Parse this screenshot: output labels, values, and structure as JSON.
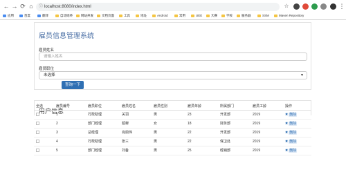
{
  "browser": {
    "url": "localhost:8080/index.html",
    "bookmarks": [
      "应用",
      "百度",
      "翻译",
      "自动始终",
      "网站开发",
      "文档页面",
      "工具",
      "地址",
      "Android",
      "常用",
      "UEE",
      "大赛",
      "学校",
      "服务器",
      "SSM",
      "Maven Repository"
    ]
  },
  "form": {
    "title": "雇员信息管理系统",
    "name_label": "雇员姓名",
    "name_placeholder": "请输入姓名",
    "position_label": "雇员职位",
    "position_value": "未选择",
    "query_button": "查询一下"
  },
  "list": {
    "title": "用户信息",
    "columns": [
      "全选",
      "雇员编号",
      "雇员职位",
      "雇员姓名",
      "雇员性别",
      "雇员年龄",
      "所属部门",
      "雇员工龄",
      "操作"
    ],
    "delete_label": "删除",
    "rows": [
      {
        "id": "1",
        "position": "行政助理",
        "name": "关羽",
        "gender": "男",
        "age": "23",
        "dept": "开发部",
        "years": "2019"
      },
      {
        "id": "2",
        "position": "部门经理",
        "name": "貂蝉",
        "gender": "女",
        "age": "18",
        "dept": "财务部",
        "years": "2019"
      },
      {
        "id": "3",
        "position": "总经理",
        "name": "肖丽伟",
        "gender": "男",
        "age": "22",
        "dept": "开发部",
        "years": "2019"
      },
      {
        "id": "4",
        "position": "行政助理",
        "name": "张三",
        "gender": "男",
        "age": "22",
        "dept": "保卫处",
        "years": "2019"
      },
      {
        "id": "5",
        "position": "部门经理",
        "name": "刘备",
        "gender": "男",
        "age": "25",
        "dept": "经销部",
        "years": "2019"
      }
    ]
  }
}
